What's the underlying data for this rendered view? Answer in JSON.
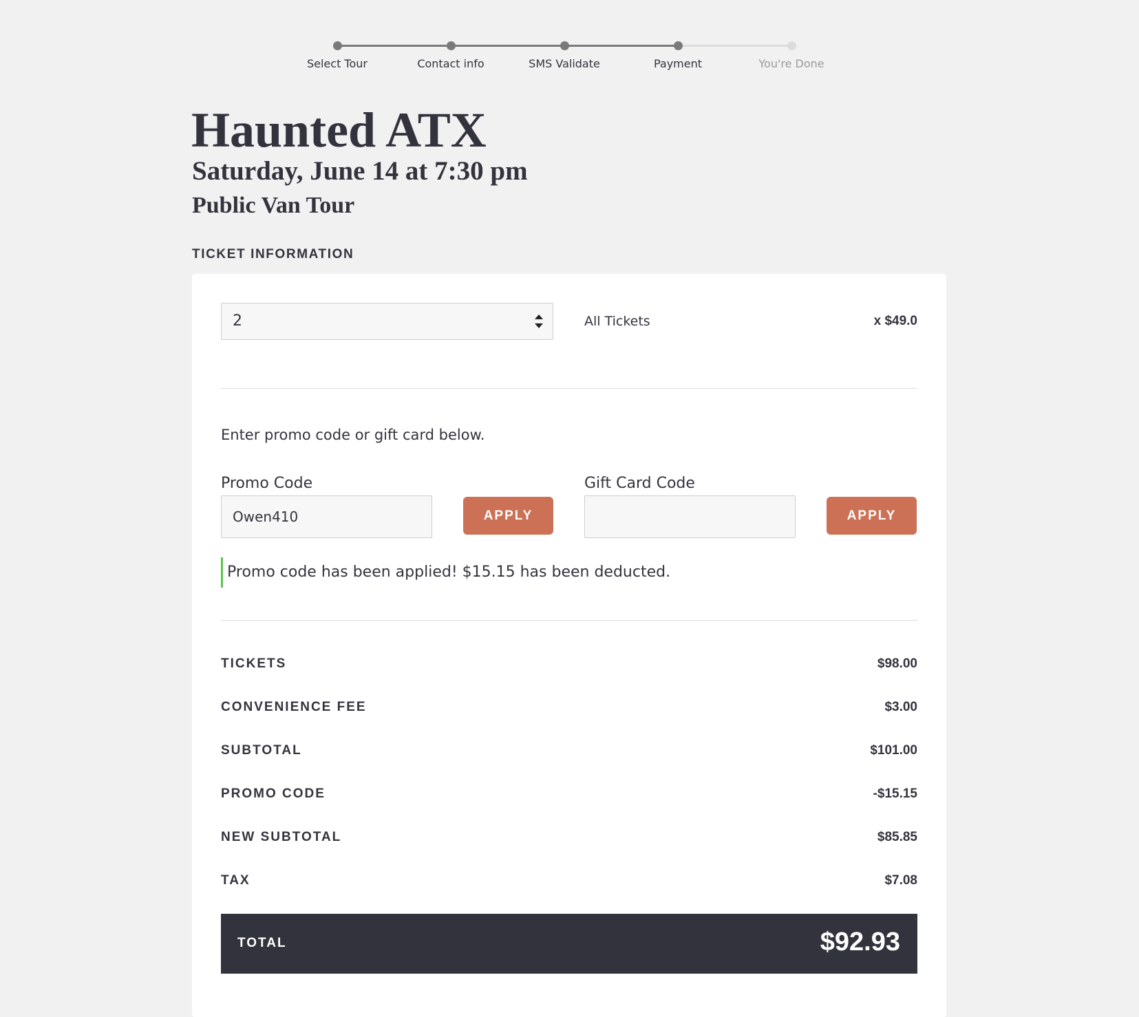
{
  "steps": {
    "items": [
      {
        "label": "Select Tour",
        "state": "complete"
      },
      {
        "label": "Contact info",
        "state": "complete"
      },
      {
        "label": "SMS Validate",
        "state": "complete"
      },
      {
        "label": "Payment",
        "state": "current"
      },
      {
        "label": "You're Done",
        "state": "pending"
      }
    ]
  },
  "tour": {
    "title": "Haunted ATX",
    "datetime": "Saturday, June 14 at 7:30 pm",
    "type": "Public Van Tour"
  },
  "ticket_section": {
    "heading": "TICKET INFORMATION",
    "quantity": "2",
    "ticket_type": "All Tickets",
    "unit_price": "x $49.0"
  },
  "promo": {
    "intro": "Enter promo code or gift card below.",
    "promo_label": "Promo Code",
    "promo_value": "Owen410",
    "gift_label": "Gift Card Code",
    "gift_value": "",
    "apply_label": "APPLY",
    "success_message": "Promo code has been applied! $15.15 has been deducted."
  },
  "summary": {
    "rows": [
      {
        "label": "TICKETS",
        "value": "$98.00"
      },
      {
        "label": "CONVENIENCE FEE",
        "value": "$3.00"
      },
      {
        "label": "SUBTOTAL",
        "value": "$101.00"
      },
      {
        "label": "PROMO CODE",
        "value": "-$15.15"
      },
      {
        "label": "NEW SUBTOTAL",
        "value": "$85.85"
      },
      {
        "label": "TAX",
        "value": "$7.08"
      }
    ],
    "total_label": "TOTAL",
    "total_value": "$92.93"
  },
  "colors": {
    "accent": "#cc7156",
    "dark": "#33333d",
    "success": "#5bc44b",
    "background": "#f1f1f1"
  }
}
